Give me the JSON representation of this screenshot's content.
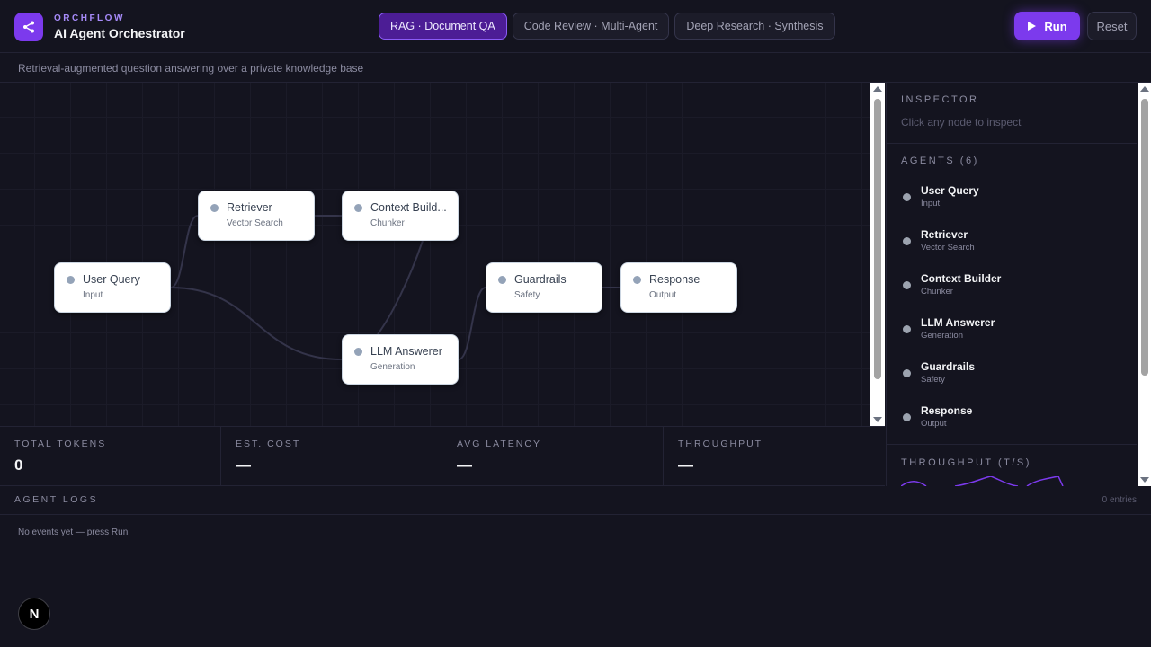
{
  "header": {
    "brand_small": "ORCHFLOW",
    "title": "AI Agent Orchestrator",
    "logo_icon": "share-icon",
    "tabs": [
      {
        "label": "RAG · Document QA",
        "active": true
      },
      {
        "label": "Code Review · Multi-Agent",
        "active": false
      },
      {
        "label": "Deep Research · Synthesis",
        "active": false
      }
    ],
    "run_label": "Run",
    "reset_label": "Reset"
  },
  "subheader": {
    "description": "Retrieval-augmented question answering over a private knowledge base"
  },
  "canvas": {
    "nodes": [
      {
        "name": "User Query",
        "type": "Input"
      },
      {
        "name": "Retriever",
        "type": "Vector Search"
      },
      {
        "name": "Context Build...",
        "type": "Chunker"
      },
      {
        "name": "LLM Answerer",
        "type": "Generation"
      },
      {
        "name": "Guardrails",
        "type": "Safety"
      },
      {
        "name": "Response",
        "type": "Output"
      }
    ]
  },
  "stats": [
    {
      "label": "TOTAL TOKENS",
      "value": "0"
    },
    {
      "label": "EST. COST",
      "value": "—"
    },
    {
      "label": "AVG LATENCY",
      "value": "—"
    },
    {
      "label": "THROUGHPUT",
      "value": "—"
    }
  ],
  "inspector": {
    "title": "INSPECTOR",
    "hint": "Click any node to inspect"
  },
  "agents": {
    "title": "AGENTS (6)",
    "items": [
      {
        "name": "User Query",
        "type": "Input"
      },
      {
        "name": "Retriever",
        "type": "Vector Search"
      },
      {
        "name": "Context Builder",
        "type": "Chunker"
      },
      {
        "name": "LLM Answerer",
        "type": "Generation"
      },
      {
        "name": "Guardrails",
        "type": "Safety"
      },
      {
        "name": "Response",
        "type": "Output"
      }
    ]
  },
  "throughput_panel": {
    "title": "THROUGHPUT (T/S)"
  },
  "logs": {
    "title": "AGENT LOGS",
    "count": "0 entries",
    "empty": "No events yet — press Run"
  },
  "badge": {
    "letter": "N"
  },
  "colors": {
    "accent": "#7c3aed",
    "background": "#14141f"
  }
}
